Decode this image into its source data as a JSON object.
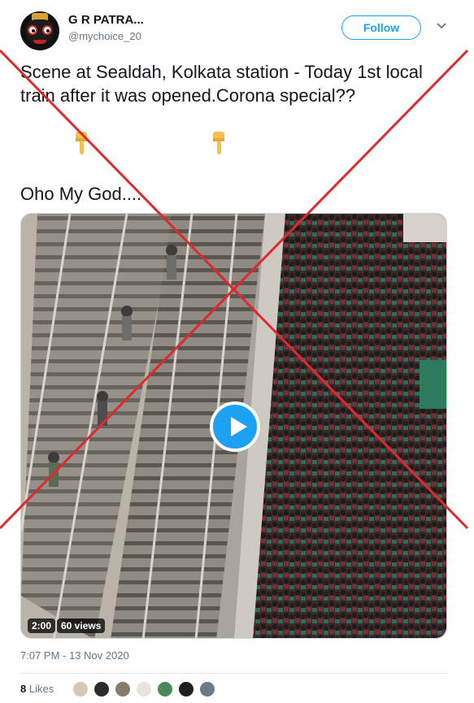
{
  "author": {
    "name": "G R PATRA...",
    "handle": "@mychoice_20",
    "follow_label": "Follow"
  },
  "tweet": {
    "text": "Scene at Sealdah, Kolkata station - Today 1st local train after it was opened.Corona special??",
    "emoji": "👇",
    "second_line": "Oho My God...."
  },
  "video": {
    "duration": "2:00",
    "views": "60 views"
  },
  "timestamp": "7:07 PM - 13 Nov 2020",
  "likes": {
    "count": "8",
    "label": "Likes"
  },
  "colors": {
    "accent": "#1da1f2",
    "cross": "#e0292f",
    "text": "#14171a",
    "muted": "#657786"
  },
  "icons": {
    "more": "chevron-down-icon",
    "play": "play-icon",
    "pointing": "pointing-down-emoji"
  }
}
